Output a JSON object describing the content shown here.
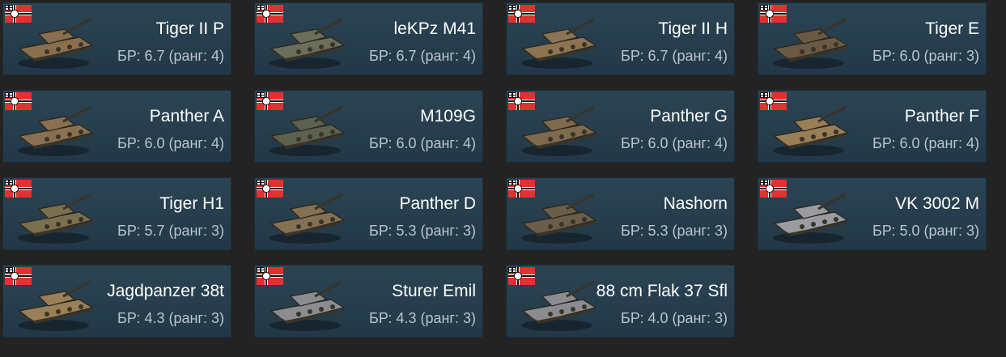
{
  "flag_icon": "germany-war-flag-icon",
  "vehicles": [
    {
      "name": "Tiger II P",
      "br_text": "БР: 6.7 (ранг: 4)",
      "icon": "tiger-ii-tank-icon",
      "camo": "#8a6f4e"
    },
    {
      "name": "leKPz M41",
      "br_text": "БР: 6.7 (ранг: 4)",
      "icon": "light-tank-icon",
      "camo": "#6b6e5a"
    },
    {
      "name": "Tiger II H",
      "br_text": "БР: 6.7 (ранг: 4)",
      "icon": "tiger-ii-tank-icon",
      "camo": "#8c7452"
    },
    {
      "name": "Tiger E",
      "br_text": "БР: 6.0 (ранг: 3)",
      "icon": "heavy-tank-icon",
      "camo": "#6a5a44"
    },
    {
      "name": "Panther A",
      "br_text": "БР: 6.0 (ранг: 4)",
      "icon": "panther-tank-icon",
      "camo": "#8a7050"
    },
    {
      "name": "M109G",
      "br_text": "БР: 6.0 (ранг: 4)",
      "icon": "self-propelled-howitzer-icon",
      "camo": "#5c6150"
    },
    {
      "name": "Panther G",
      "br_text": "БР: 6.0 (ранг: 4)",
      "icon": "panther-tank-icon",
      "camo": "#7e6a4c"
    },
    {
      "name": "Panther F",
      "br_text": "БР: 6.0 (ранг: 4)",
      "icon": "panther-tank-icon",
      "camo": "#9a7e58"
    },
    {
      "name": "Tiger H1",
      "br_text": "БР: 5.7 (ранг: 3)",
      "icon": "heavy-tank-icon",
      "camo": "#7a7050"
    },
    {
      "name": "Panther D",
      "br_text": "БР: 5.3 (ранг: 3)",
      "icon": "panther-tank-icon",
      "camo": "#857052"
    },
    {
      "name": "Nashorn",
      "br_text": "БР: 5.3 (ранг: 3)",
      "icon": "tank-destroyer-icon",
      "camo": "#6a5e48"
    },
    {
      "name": "VK 3002 M",
      "br_text": "БР: 5.0 (ранг: 3)",
      "icon": "medium-tank-icon",
      "camo": "#9a9ca0"
    },
    {
      "name": "Jagdpanzer 38t",
      "br_text": "БР: 4.3 (ранг: 3)",
      "icon": "tank-destroyer-icon",
      "camo": "#9a8058"
    },
    {
      "name": "Sturer Emil",
      "br_text": "БР: 4.3 (ранг: 3)",
      "icon": "tank-destroyer-icon",
      "camo": "#8a8c90"
    },
    {
      "name": "88 cm Flak 37 Sfl",
      "br_text": "БР: 4.0 (ранг: 3)",
      "icon": "self-propelled-gun-icon",
      "camo": "#8a8c90"
    }
  ]
}
